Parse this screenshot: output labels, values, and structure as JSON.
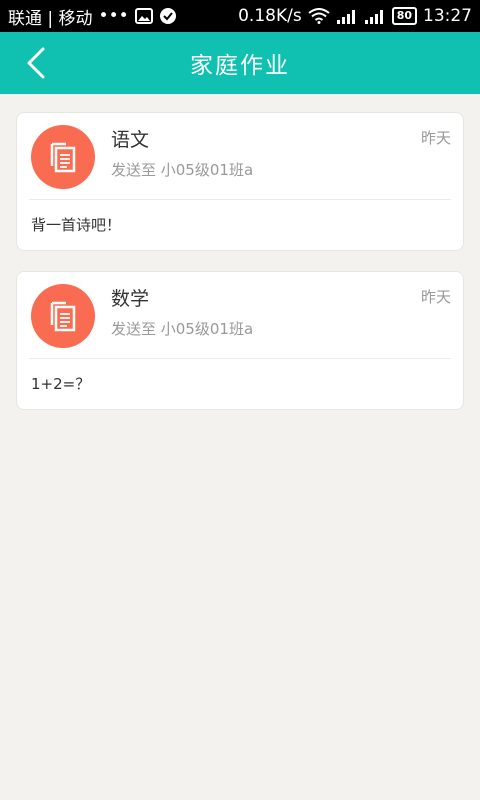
{
  "status_bar": {
    "carrier": "联通 | 移动",
    "dots": "•••",
    "speed": "0.18K/s",
    "battery": "80",
    "time": "13:27"
  },
  "header": {
    "title": "家庭作业"
  },
  "homework": [
    {
      "subject": "语文",
      "target": "发送至 小05级01班a",
      "time": "昨天",
      "content": "背一首诗吧！"
    },
    {
      "subject": "数学",
      "target": "发送至 小05级01班a",
      "time": "昨天",
      "content": "1+2=？"
    }
  ],
  "colors": {
    "header": "#10c1b2",
    "icon_bg": "#f96c51",
    "page_bg": "#f3f2ee"
  }
}
